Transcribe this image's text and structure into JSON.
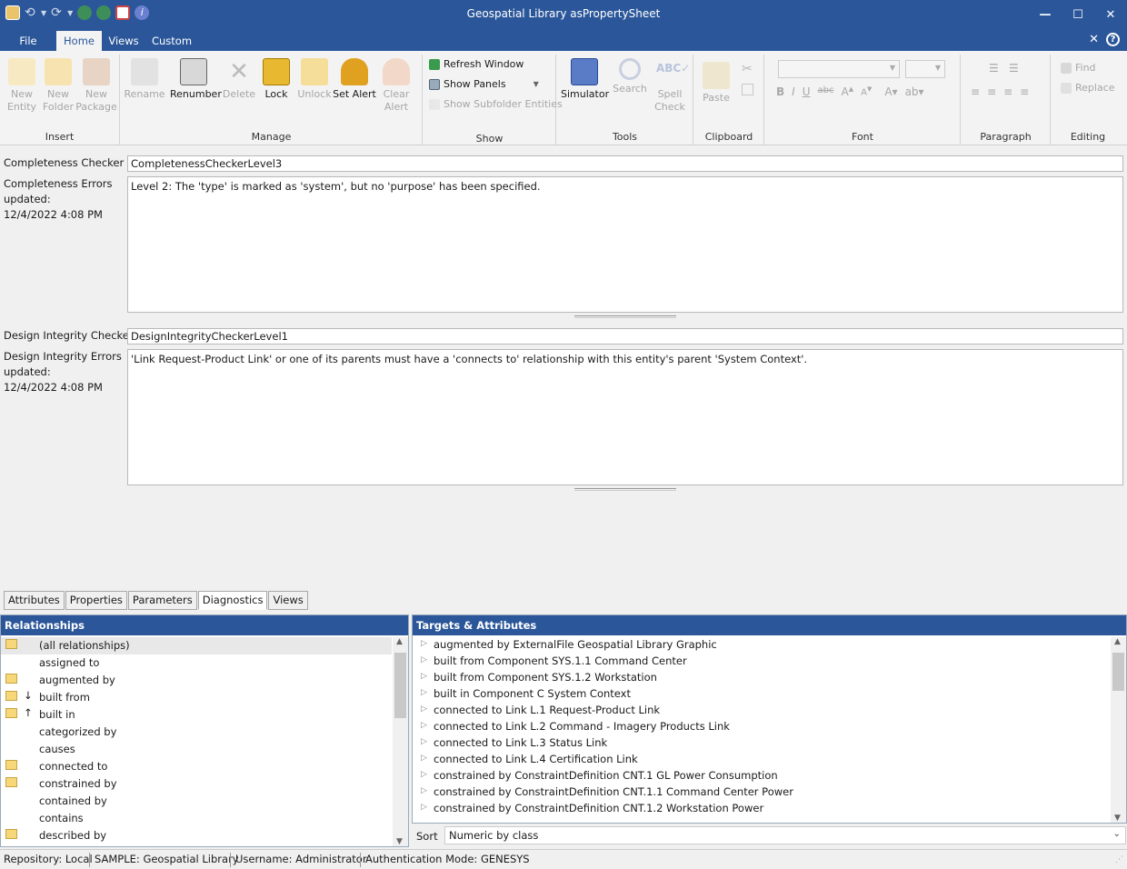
{
  "window": {
    "title": "Geospatial Library asPropertySheet"
  },
  "menu": {
    "tabs": [
      "File",
      "Home",
      "Views",
      "Custom"
    ]
  },
  "ribbon": {
    "insert": {
      "title": "Insert",
      "new_entity": "New Entity",
      "new_folder": "New Folder",
      "new_package": "New Package"
    },
    "manage": {
      "title": "Manage",
      "rename": "Rename",
      "renumber": "Renumber",
      "delete": "Delete",
      "lock": "Lock",
      "unlock": "Unlock",
      "set_alert": "Set Alert",
      "clear_alert": "Clear Alert"
    },
    "show": {
      "title": "Show",
      "refresh": "Refresh Window",
      "panels": "Show Panels",
      "subfolder": "Show Subfolder Entities"
    },
    "tools": {
      "title": "Tools",
      "simulator": "Simulator",
      "search": "Search",
      "spell": "Spell Check"
    },
    "clipboard": {
      "title": "Clipboard",
      "paste": "Paste"
    },
    "font": {
      "title": "Font"
    },
    "paragraph": {
      "title": "Paragraph"
    },
    "editing": {
      "title": "Editing",
      "find": "Find",
      "replace": "Replace"
    }
  },
  "diagnostics": {
    "completeness_label": "Completeness Checker",
    "completeness_value": "CompletenessCheckerLevel3",
    "completeness_errors_label": "Completeness Errors",
    "updated_label": "updated:",
    "completeness_updated": "12/4/2022 4:08 PM",
    "completeness_errors_text": "Level 2: The 'type' is marked as 'system', but no 'purpose' has been specified.",
    "integrity_label": "Design Integrity Checker",
    "integrity_value": "DesignIntegrityCheckerLevel1",
    "integrity_errors_label": "Design Integrity Errors",
    "integrity_updated": "12/4/2022 4:08 PM",
    "integrity_errors_text": "'Link Request-Product Link' or one of its parents must have a 'connects to' relationship with this entity's parent 'System Context'."
  },
  "bottom_tabs": [
    "Attributes",
    "Properties",
    "Parameters",
    "Diagnostics",
    "Views"
  ],
  "relationships": {
    "title": "Relationships",
    "items": [
      {
        "label": "(all relationships)",
        "folder": true,
        "arrow": ""
      },
      {
        "label": "assigned to",
        "folder": false,
        "arrow": ""
      },
      {
        "label": "augmented by",
        "folder": true,
        "arrow": ""
      },
      {
        "label": "built from",
        "folder": true,
        "arrow": "↓"
      },
      {
        "label": "built in",
        "folder": true,
        "arrow": "↑"
      },
      {
        "label": "categorized by",
        "folder": false,
        "arrow": ""
      },
      {
        "label": "causes",
        "folder": false,
        "arrow": ""
      },
      {
        "label": "connected to",
        "folder": true,
        "arrow": ""
      },
      {
        "label": "constrained by",
        "folder": true,
        "arrow": ""
      },
      {
        "label": "contained by",
        "folder": false,
        "arrow": ""
      },
      {
        "label": "contains",
        "folder": false,
        "arrow": ""
      },
      {
        "label": "described by",
        "folder": true,
        "arrow": ""
      }
    ]
  },
  "targets": {
    "title": "Targets & Attributes",
    "items": [
      "augmented by ExternalFile  Geospatial Library Graphic",
      "built from Component SYS.1.1 Command Center",
      "built from Component SYS.1.2 Workstation",
      "built in Component C System Context",
      "connected to Link L.1 Request-Product Link",
      "connected to Link L.2 Command - Imagery Products Link",
      "connected to Link L.3 Status Link",
      "connected to Link L.4 Certification Link",
      "constrained by ConstraintDefinition CNT.1 GL Power Consumption",
      "constrained by ConstraintDefinition CNT.1.1 Command Center Power",
      "constrained by ConstraintDefinition CNT.1.2 Workstation Power"
    ]
  },
  "sort": {
    "label": "Sort",
    "value": "Numeric by class"
  },
  "status": {
    "repository": "Repository: Local",
    "project": "SAMPLE: Geospatial Library",
    "username": "Username: Administrator",
    "auth": "Authentication Mode: GENESYS"
  },
  "colors": {
    "accent": "#2b579a"
  }
}
